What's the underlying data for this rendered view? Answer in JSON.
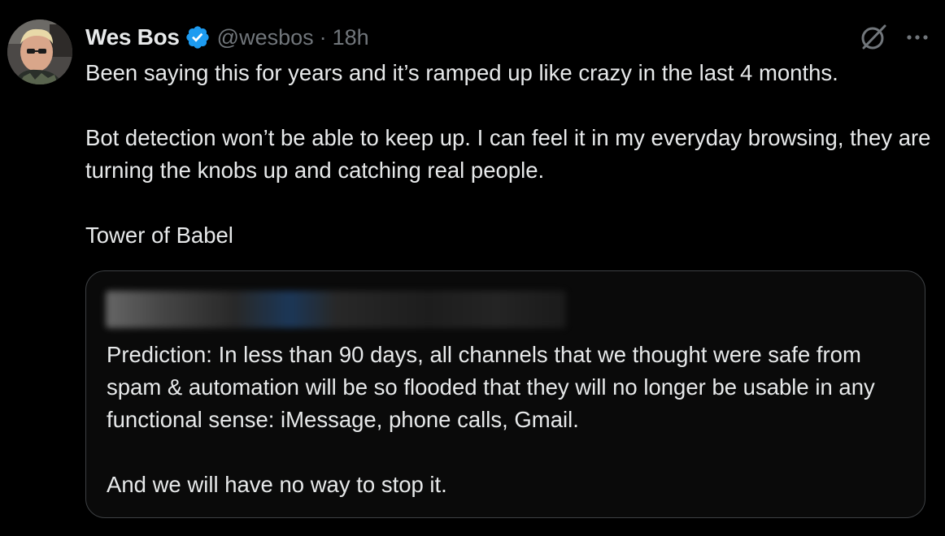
{
  "tweet": {
    "author": {
      "display_name": "Wes Bos",
      "handle": "@wesbos",
      "verified": true
    },
    "separator": "·",
    "time": "18h",
    "paragraphs": [
      "Been saying this for years and it’s ramped up like crazy in the last 4 months.",
      "Bot detection won’t be able to keep up. I can feel it in my everyday browsing, they are turning the knobs up and catching real people.",
      "Tower of Babel"
    ],
    "icons": {
      "verified": "verified-badge-icon",
      "grok": "grok-icon",
      "more": "more-horizontal-icon"
    }
  },
  "quoted_tweet": {
    "author_redacted": true,
    "paragraphs": [
      "Prediction: In less than 90 days, all channels that we thought were safe from spam & automation will be so flooded that they will no longer be usable in any functional sense: iMessage, phone calls, Gmail.",
      "And we will have no way to stop it."
    ]
  },
  "colors": {
    "background": "#000000",
    "text_primary": "#e7e9ea",
    "text_secondary": "#71767b",
    "verified_blue": "#1d9bf0",
    "quote_border": "#3e4144"
  }
}
